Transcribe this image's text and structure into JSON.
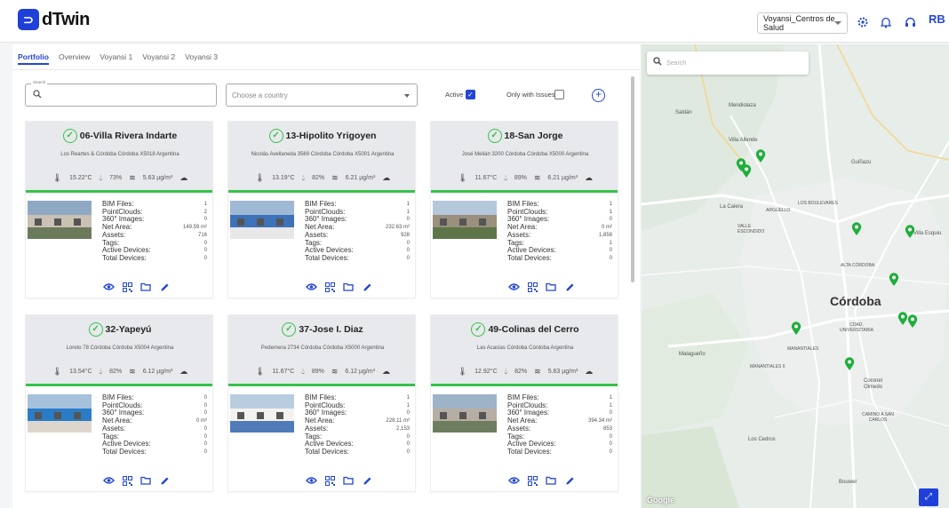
{
  "app": {
    "logo_mark": "⊃",
    "name": "dTwin"
  },
  "header": {
    "org_select": "Voyansi_Centros de Salud",
    "icons": [
      "settings-icon",
      "bell-icon",
      "headset-icon"
    ],
    "avatar": "RB"
  },
  "tabs": [
    "Portfolio",
    "Overview",
    "Voyansi 1",
    "Voyansi 2",
    "Voyansi 3"
  ],
  "filters": {
    "search_label": "Search",
    "search_value": "",
    "country_placeholder": "Choose a country",
    "active_label": "Active",
    "active_checked": true,
    "issues_label": "Only with Issues",
    "issues_checked": false
  },
  "stat_labels": [
    "BIM Files:",
    "PointClouds:",
    "360° Images:",
    "Net Area:",
    "Assets:",
    "Tags:",
    "Active Devices:",
    "Total Devices:"
  ],
  "cards": [
    {
      "title": "06-Villa Rivera Indarte",
      "address": "Los Reartes & Córdoba Córdoba X5018 Argentina",
      "temp": "15.22°C",
      "humidity": "73%",
      "pm": "5.63 µg/m³",
      "stats": [
        "1",
        "2",
        "0",
        "149.59 m²",
        "716",
        "0",
        "0",
        "0"
      ]
    },
    {
      "title": "13-Hipolito Yrigoyen",
      "address": "Nicolás Avellaneda 3569 Córdoba Córdoba X5001 Argentina",
      "temp": "13.19°C",
      "humidity": "82%",
      "pm": "6.21 µg/m³",
      "stats": [
        "1",
        "1",
        "0",
        "232.63 m²",
        "928",
        "0",
        "0",
        "0"
      ]
    },
    {
      "title": "18-San Jorge",
      "address": "José Melián 3200 Córdoba Córdoba X5000 Argentina",
      "temp": "11.67°C",
      "humidity": "89%",
      "pm": "6.21 µg/m³",
      "stats": [
        "1",
        "1",
        "0",
        "0 m²",
        "1,858",
        "1",
        "0",
        "0"
      ]
    },
    {
      "title": "32-Yapeyú",
      "address": "Loreto 78 Córdoba Córdoba X5004 Argentina",
      "temp": "13.54°C",
      "humidity": "82%",
      "pm": "6.12 µg/m³",
      "stats": [
        "0",
        "0",
        "0",
        "0 m²",
        "0",
        "0",
        "0",
        "0"
      ]
    },
    {
      "title": "37-Jose I. Diaz",
      "address": "Pedernera 2734 Córdoba Córdoba X5000 Argentina",
      "temp": "11.67°C",
      "humidity": "89%",
      "pm": "6.12 µg/m³",
      "stats": [
        "1",
        "1",
        "0",
        "228.11 m²",
        "2,153",
        "0",
        "0",
        "0"
      ]
    },
    {
      "title": "49-Colinas del Cerro",
      "address": "Las Acacias Córdoba Córdoba Argentina",
      "temp": "12.92°C",
      "humidity": "82%",
      "pm": "5.63 µg/m³",
      "stats": [
        "1",
        "1",
        "0",
        "394.34 m²",
        "853",
        "0",
        "0",
        "0"
      ]
    }
  ],
  "card_actions": [
    "eye-icon",
    "qr-icon",
    "folder-icon",
    "edit-icon"
  ],
  "map": {
    "search_placeholder": "Search",
    "city": "Córdoba",
    "labels": [
      "Saldán",
      "Mendiolaza",
      "Villa Allende",
      "Guiñazu",
      "La Calera",
      "ARGÜELLO",
      "LOS BOULEVARES",
      "VALLE ESCONDIDO",
      "Villa Esquiu",
      "ALTA CÓRDOBA",
      "CDAD. UNIVERSITARIA",
      "MANANTIALES",
      "Malagueño",
      "MANANTIALES II",
      "Coronel Olmedo",
      "CAMINO A SAN CARLOS",
      "Los Cedros",
      "Bouwer"
    ],
    "attribution": "Google"
  },
  "colors": {
    "accent": "#2346d6",
    "ok": "#35c24a",
    "pin": "#1fae3a"
  }
}
